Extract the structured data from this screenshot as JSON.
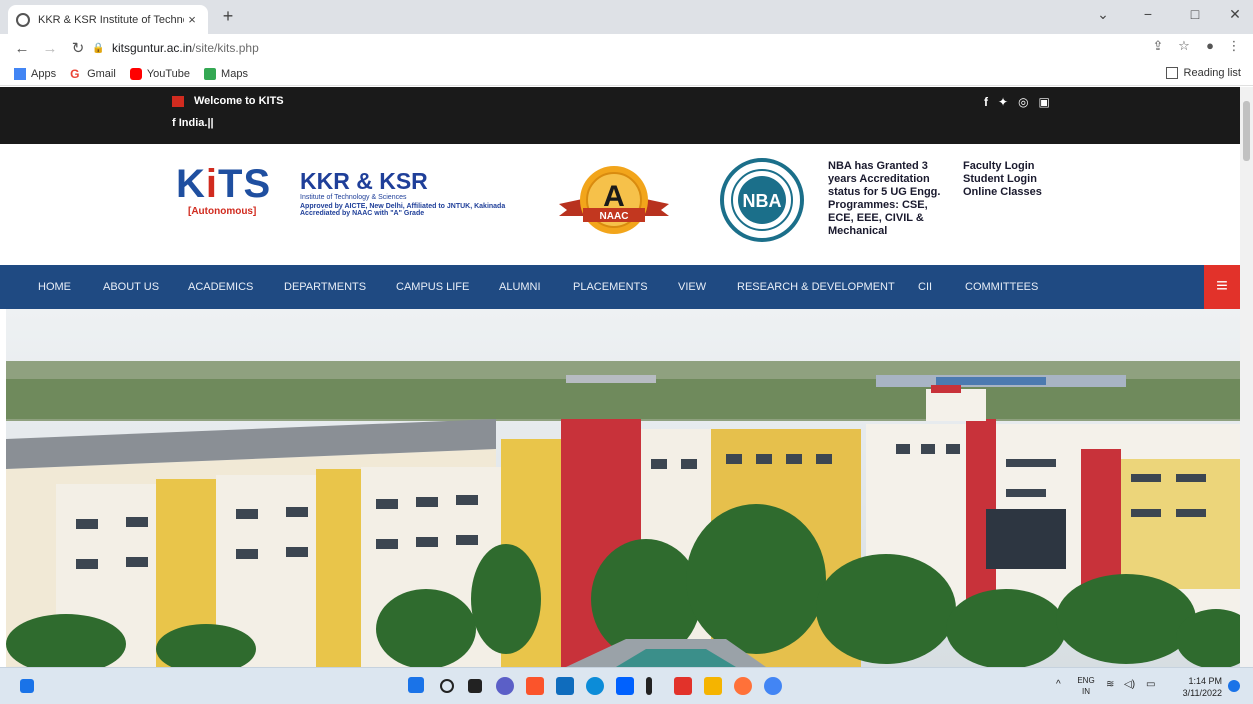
{
  "browser": {
    "tab_title": "KKR & KSR Institute of Technolo",
    "tab_close": "×",
    "new_tab": "+",
    "url_domain": "kitsguntur.ac.in",
    "url_path": "/site/kits.php",
    "window_controls": {
      "chevron": "⌄",
      "minimize": "−",
      "maximize": "□",
      "close": "✕"
    },
    "bookmarks": [
      {
        "label": "Apps",
        "color": "#4285f4"
      },
      {
        "label": "Gmail",
        "color": "#ea4335"
      },
      {
        "label": "YouTube",
        "color": "#ff0000"
      },
      {
        "label": "Maps",
        "color": "#34a853"
      }
    ],
    "reading_list": "Reading list"
  },
  "topbar": {
    "welcome": "Welcome to KITS",
    "marquee": "f India.||",
    "social_icons": [
      "f",
      "🐦",
      "◎",
      "▣"
    ]
  },
  "header": {
    "logo_word_1": "K",
    "logo_word_2": "i",
    "logo_word_3": "TS",
    "logo_sub": "[Autonomous]",
    "inst_title": "KKR & KSR",
    "inst_line1": "Institute of Technology & Sciences",
    "inst_line2": "Approved by AICTE, New Delhi, Affiliated to JNTUK, Kakinada",
    "inst_line3": "Accrediated by NAAC with  \"A\"  Grade",
    "naac_grade": "A",
    "naac_label": "NAAC",
    "nba_label": "NBA",
    "nba_text": "NBA has Granted 3 years Accreditation status for 5 UG Engg. Programmes: CSE, ECE, EEE, CIVIL & Mechanical",
    "logins": [
      "Faculty Login",
      "Student Login",
      "Online Classes"
    ]
  },
  "nav": {
    "items": [
      "HOME",
      "ABOUT US",
      "ACADEMICS",
      "DEPARTMENTS",
      "CAMPUS LIFE",
      "ALUMNI",
      "PLACEMENTS",
      "VIEW",
      "RESEARCH & DEVELOPMENT",
      "CII",
      "COMMITTEES"
    ],
    "menu_icon": "≡"
  },
  "taskbar": {
    "lang_top": "ENG",
    "lang_bottom": "IN",
    "time": "1:14 PM",
    "date": "3/11/2022"
  },
  "colors": {
    "nav_bg": "#1f4a82",
    "accent_red": "#e2322a",
    "brand_blue": "#1f4fa0",
    "top_strip": "#1a1a1a"
  }
}
